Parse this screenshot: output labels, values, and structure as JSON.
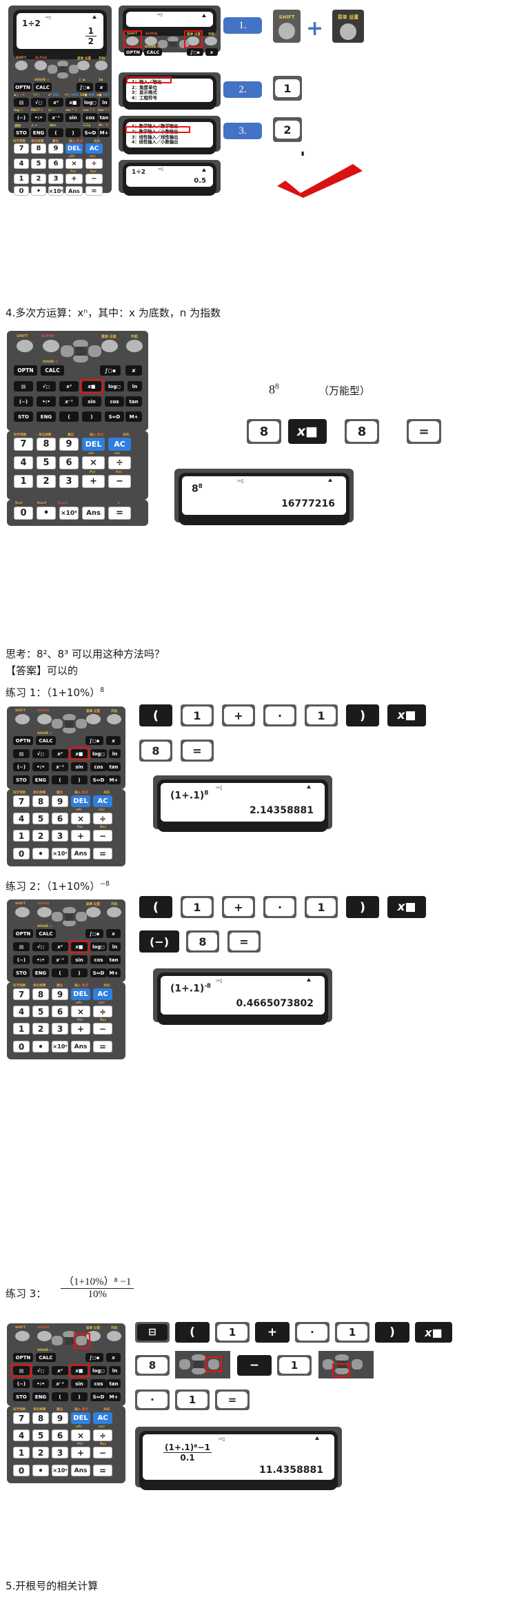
{
  "section3": {
    "display1": {
      "expr": "1÷2",
      "result_num": "1",
      "result_den": "2"
    },
    "panel1": {
      "caption": "SHIFT + 菜单 设置"
    },
    "panel2_menu": [
      "1：输入／输出",
      "2：角度单位",
      "3：显示格式",
      "4：工程符号"
    ],
    "panel3_menu": [
      "1：数学输入／数学输出",
      "2：数学输入／小数输出",
      "3：线性输入／线性输出",
      "4：线性输入／小数输出"
    ],
    "panel4": {
      "expr": "1÷2",
      "result": "0.5"
    },
    "steps": [
      {
        "label": "1.",
        "keys": [
          "SHIFT",
          "菜单 设置"
        ],
        "plus": "+"
      },
      {
        "label": "2.",
        "keys": [
          "1"
        ]
      },
      {
        "label": "3.",
        "keys": [
          "2"
        ]
      }
    ]
  },
  "section4": {
    "heading": "4.多次方运算：xⁿ，其中：x 为底数，n 为指数",
    "example_expr": "8",
    "example_exp": "8",
    "example_note": "（万能型）",
    "keys": [
      "8",
      "x■",
      "8",
      "="
    ],
    "display": {
      "expr": "8",
      "expr_exp": "8",
      "result": "16777216"
    }
  },
  "think": {
    "question": "思考：8²、8³ 可以用这种方法吗？",
    "answer": "【答案】可以的"
  },
  "practice1": {
    "title": "练习 1：（1+10%）",
    "title_exp": "8",
    "keys_row1": [
      "(",
      "1",
      "+",
      "·",
      "1",
      ")",
      "x■"
    ],
    "keys_row2": [
      "8",
      "="
    ],
    "display": {
      "expr": "(1+.1)",
      "expr_exp": "8",
      "result": "2.14358881"
    }
  },
  "practice2": {
    "title": "练习 2：（1+10%）",
    "title_exp": "−8",
    "keys_row1": [
      "(",
      "1",
      "+",
      "·",
      "1",
      ")",
      "x■"
    ],
    "keys_row2": [
      "(−)",
      "8",
      "="
    ],
    "display": {
      "expr": "(1+.1)",
      "expr_exp": "-8",
      "result": "0.4665073802"
    }
  },
  "practice3": {
    "title_prefix": "练习 3：",
    "frac_num": "（1+10%）⁸ −1",
    "frac_den": "10%",
    "keys_row1": [
      "⊟",
      "(",
      "1",
      "+",
      "·",
      "1",
      ")",
      "x■"
    ],
    "keys_row2": [
      "8",
      "[dpad]",
      "−",
      "1",
      "[dpad]"
    ],
    "keys_row3": [
      "·",
      "1",
      "="
    ],
    "display": {
      "line1_num": "(1+.1)⁸−1",
      "line1_den": "0.1",
      "result": "11.4358881"
    }
  },
  "section5": {
    "heading": "5.开根号的相关计算"
  },
  "calculator_keypad": {
    "top_labels": [
      "SHIFT",
      "ALPHA",
      "菜单 设置",
      "开机"
    ],
    "row_solve": "SOLVE ≡",
    "func_keys": [
      "OPTN",
      "CALC",
      "∫◻",
      "x"
    ],
    "row2_sub": [
      "▪◻ ÷R",
      "³√◻",
      "x³  DEC",
      "ⁿ√◻ HEX",
      "10■ BIN",
      "e■ OCT"
    ],
    "row2": [
      "▤",
      "√◻",
      "x²",
      "x■",
      "log◻",
      "ln"
    ],
    "row3_sub": [
      "log  A",
      "FACT  B",
      "x⁻¹  C",
      "sin⁻¹  D",
      "cos⁻¹  E",
      "tan⁻¹  F"
    ],
    "row3": [
      "(−)",
      "•:•",
      "x⁻¹",
      "sin",
      "cos",
      "tan"
    ],
    "row4_sub": [
      "调用",
      "∠ ←",
      "Abs",
      "'",
      "x",
      "☰☰y",
      "M−  M"
    ],
    "row4": [
      "STO",
      "ENG",
      "(",
      ")",
      "S⇔D",
      "M+"
    ],
    "row5_sub": [
      "科学常数",
      "单位换算",
      "重位",
      "插入 撤消",
      "关机"
    ],
    "row5": [
      "7",
      "8",
      "9",
      "DEL",
      "AC"
    ],
    "row6_sub": [
      "nPr",
      "nCr"
    ],
    "row6": [
      "4",
      "5",
      "6",
      "×",
      "÷"
    ],
    "row7_sub": [
      "Pol",
      "Rec"
    ],
    "row7": [
      "1",
      "2",
      "3",
      "+",
      "−"
    ],
    "row8_sub": [
      "Rnd",
      "Ranl",
      "Ran#",
      "≈"
    ],
    "row8": [
      "0",
      "•",
      "×10ˣ",
      "Ans",
      "="
    ]
  }
}
